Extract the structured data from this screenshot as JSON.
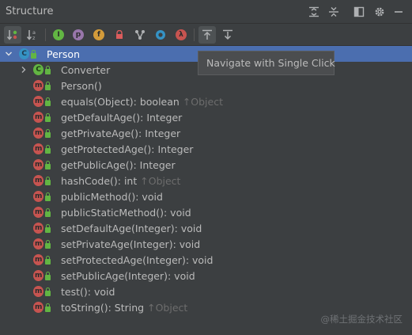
{
  "window": {
    "title": "Structure",
    "title_icons": [
      "expand-all-icon",
      "collapse-all-icon",
      "layout-icon",
      "gear-icon",
      "minimize-icon"
    ]
  },
  "toolbar": {
    "buttons": [
      {
        "name": "sort-by-visibility-icon",
        "active": true
      },
      {
        "name": "sort-alphabetically-icon",
        "active": false
      },
      {
        "name": "show-inherited-icon",
        "active": false,
        "glyph": "I"
      },
      {
        "name": "show-properties-icon",
        "active": false,
        "glyph": "p"
      },
      {
        "name": "show-fields-icon",
        "active": false,
        "glyph": "f"
      },
      {
        "name": "show-non-public-icon",
        "active": false
      },
      {
        "name": "show-anonymous-classes-icon",
        "active": false
      },
      {
        "name": "show-lambdas-circle-icon",
        "active": false
      },
      {
        "name": "show-lambdas-icon",
        "active": false,
        "glyph": "λ"
      },
      {
        "name": "navigate-single-click-icon",
        "active": true
      },
      {
        "name": "autoscroll-from-source-icon",
        "active": false
      }
    ]
  },
  "tree": {
    "root": {
      "label": "Person",
      "icon": "C"
    },
    "items": [
      {
        "label": "Converter",
        "type": "class",
        "expandable": true
      },
      {
        "label": "Person()",
        "type": "method"
      },
      {
        "label": "equals(Object): boolean",
        "inherit": "↑Object",
        "type": "method"
      },
      {
        "label": "getDefaultAge(): Integer",
        "type": "method"
      },
      {
        "label": "getPrivateAge(): Integer",
        "type": "method"
      },
      {
        "label": "getProtectedAge(): Integer",
        "type": "method"
      },
      {
        "label": "getPublicAge(): Integer",
        "type": "method"
      },
      {
        "label": "hashCode(): int",
        "inherit": "↑Object",
        "type": "method"
      },
      {
        "label": "publicMethod(): void",
        "type": "method"
      },
      {
        "label": "publicStaticMethod(): void",
        "type": "method",
        "static": true
      },
      {
        "label": "setDefaultAge(Integer): void",
        "type": "method"
      },
      {
        "label": "setPrivateAge(Integer): void",
        "type": "method"
      },
      {
        "label": "setProtectedAge(Integer): void",
        "type": "method"
      },
      {
        "label": "setPublicAge(Integer): void",
        "type": "method"
      },
      {
        "label": "test(): void",
        "type": "method"
      },
      {
        "label": "toString(): String",
        "inherit": "↑Object",
        "type": "method"
      }
    ]
  },
  "tooltip": {
    "text": "Navigate with Single Click"
  },
  "watermark": {
    "text": "@稀土掘金技术社区"
  },
  "colors": {
    "background": "#3c3f41",
    "selection": "#4b6eaf",
    "method_icon": "#c75450",
    "class_icon": "#3592c4",
    "access_lock": "#62b543"
  }
}
